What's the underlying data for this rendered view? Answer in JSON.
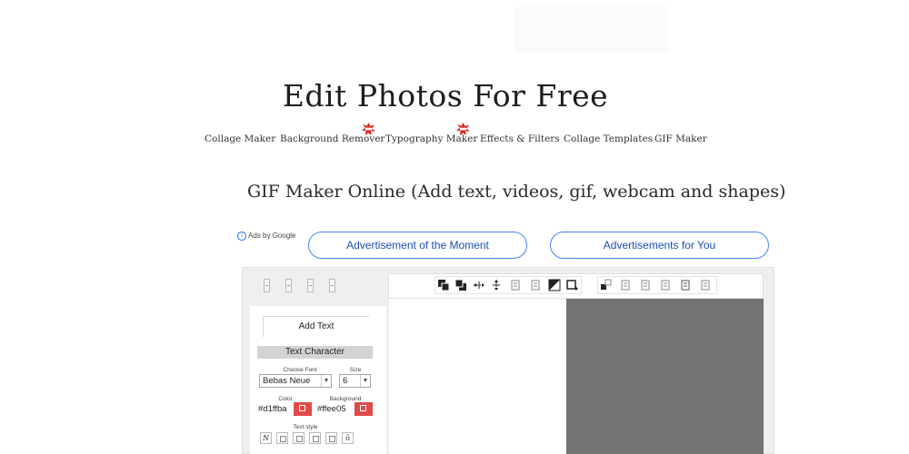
{
  "site": {
    "title": "Edit Photos For Free"
  },
  "nav": [
    {
      "label": "Collage Maker",
      "badge": false
    },
    {
      "label": "Background Remover",
      "badge": true
    },
    {
      "label": "Typography Maker",
      "badge": true
    },
    {
      "label": "Effects & Filters",
      "badge": false
    },
    {
      "label": "Collage Templates",
      "badge": false
    },
    {
      "label": "GIF Maker",
      "badge": false
    }
  ],
  "page": {
    "heading": "GIF Maker Online (Add text, videos, gif, webcam and shapes)"
  },
  "ads": {
    "ads_by_label": "Ads by",
    "ads_by_brand": "Google",
    "buttons": [
      "Advertisement of the Moment",
      "Advertisements for You"
    ]
  },
  "editor": {
    "add_text_tab": "Add Text",
    "text_character": {
      "title": "Text Character",
      "choose_font_label": "Choose Font",
      "font_value": "Bebas Neue",
      "size_label": "Size",
      "size_value": "6",
      "color_label": "Color",
      "color_value": "#d1ffba",
      "background_label": "Background",
      "background_value": "#ffee05",
      "text_style_label": "Text style",
      "style_normal": "N",
      "style_last": "ō"
    },
    "toolbar_icons": [
      "bring-forward-icon",
      "send-backward-icon",
      "align-horizontal-icon",
      "align-vertical-icon",
      "flip-horizontal-icon",
      "flip-vertical-icon",
      "contrast-icon",
      "crop-icon",
      "resize-icon",
      "copy-icon",
      "paste-icon",
      "duplicate-icon",
      "delete-icon",
      "export-icon"
    ]
  },
  "colors": {
    "accent_red": "#e04a48",
    "link_blue": "#1a4fb5",
    "canvas_gray": "#737373",
    "badge_red": "#d9231d"
  }
}
